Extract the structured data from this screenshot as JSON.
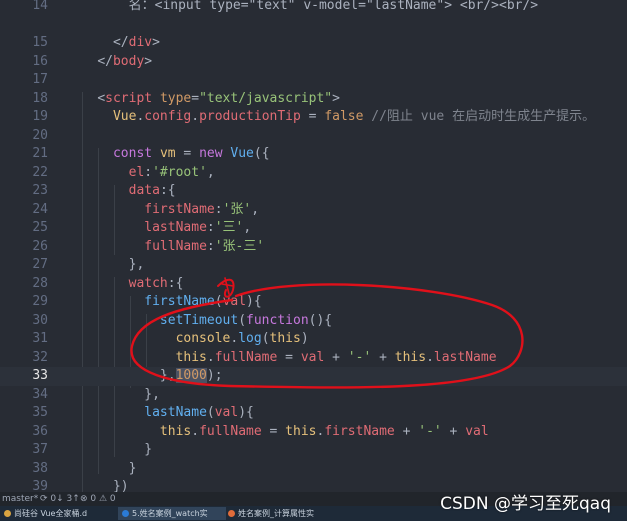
{
  "editor": {
    "current_line": 33,
    "lines": [
      {
        "no": "14",
        "tokens": [
          {
            "t": "        ",
            "c": "t-plain"
          },
          {
            "t": "名：<input type=\"text\" v-model=\"lastName\"> <br/><br/>",
            "c": "t-txt"
          }
        ]
      },
      {
        "no": "",
        "tokens": []
      },
      {
        "no": "15",
        "tokens": [
          {
            "t": "      ",
            "c": "t-plain"
          },
          {
            "t": "</",
            "c": "t-pun"
          },
          {
            "t": "div",
            "c": "t-tag"
          },
          {
            "t": ">",
            "c": "t-pun"
          }
        ]
      },
      {
        "no": "16",
        "tokens": [
          {
            "t": "    ",
            "c": "t-plain"
          },
          {
            "t": "</",
            "c": "t-pun"
          },
          {
            "t": "body",
            "c": "t-tag"
          },
          {
            "t": ">",
            "c": "t-pun"
          }
        ]
      },
      {
        "no": "17",
        "tokens": []
      },
      {
        "no": "18",
        "tokens": [
          {
            "t": "    ",
            "c": "t-plain"
          },
          {
            "t": "<",
            "c": "t-pun"
          },
          {
            "t": "script",
            "c": "t-tag"
          },
          {
            "t": " ",
            "c": "t-plain"
          },
          {
            "t": "type",
            "c": "t-attr"
          },
          {
            "t": "=",
            "c": "t-pun"
          },
          {
            "t": "\"text/javascript\"",
            "c": "t-str"
          },
          {
            "t": ">",
            "c": "t-pun"
          }
        ]
      },
      {
        "no": "19",
        "tokens": [
          {
            "t": "      ",
            "c": "t-plain"
          },
          {
            "t": "Vue",
            "c": "t-this"
          },
          {
            "t": ".",
            "c": "t-pun"
          },
          {
            "t": "config",
            "c": "t-prop"
          },
          {
            "t": ".",
            "c": "t-pun"
          },
          {
            "t": "productionTip",
            "c": "t-prop"
          },
          {
            "t": " = ",
            "c": "t-pun"
          },
          {
            "t": "false",
            "c": "t-num"
          },
          {
            "t": " ",
            "c": "t-plain"
          },
          {
            "t": "//阻止 vue 在启动时生成生产提示。",
            "c": "t-cm"
          }
        ]
      },
      {
        "no": "20",
        "tokens": []
      },
      {
        "no": "21",
        "tokens": [
          {
            "t": "      ",
            "c": "t-plain"
          },
          {
            "t": "const",
            "c": "t-kw"
          },
          {
            "t": " ",
            "c": "t-plain"
          },
          {
            "t": "vm",
            "c": "t-this"
          },
          {
            "t": " = ",
            "c": "t-pun"
          },
          {
            "t": "new",
            "c": "t-kw"
          },
          {
            "t": " ",
            "c": "t-plain"
          },
          {
            "t": "Vue",
            "c": "t-fn"
          },
          {
            "t": "({",
            "c": "t-pun"
          }
        ]
      },
      {
        "no": "22",
        "tokens": [
          {
            "t": "        ",
            "c": "t-plain"
          },
          {
            "t": "el",
            "c": "t-prop"
          },
          {
            "t": ":",
            "c": "t-pun"
          },
          {
            "t": "'#root'",
            "c": "t-str"
          },
          {
            "t": ",",
            "c": "t-pun"
          }
        ]
      },
      {
        "no": "23",
        "tokens": [
          {
            "t": "        ",
            "c": "t-plain"
          },
          {
            "t": "data",
            "c": "t-prop"
          },
          {
            "t": ":{",
            "c": "t-pun"
          }
        ]
      },
      {
        "no": "24",
        "tokens": [
          {
            "t": "          ",
            "c": "t-plain"
          },
          {
            "t": "firstName",
            "c": "t-prop"
          },
          {
            "t": ":",
            "c": "t-pun"
          },
          {
            "t": "'张'",
            "c": "t-str"
          },
          {
            "t": ",",
            "c": "t-pun"
          }
        ]
      },
      {
        "no": "25",
        "tokens": [
          {
            "t": "          ",
            "c": "t-plain"
          },
          {
            "t": "lastName",
            "c": "t-prop"
          },
          {
            "t": ":",
            "c": "t-pun"
          },
          {
            "t": "'三'",
            "c": "t-str"
          },
          {
            "t": ",",
            "c": "t-pun"
          }
        ]
      },
      {
        "no": "26",
        "tokens": [
          {
            "t": "          ",
            "c": "t-plain"
          },
          {
            "t": "fullName",
            "c": "t-prop"
          },
          {
            "t": ":",
            "c": "t-pun"
          },
          {
            "t": "'张-三'",
            "c": "t-str"
          }
        ]
      },
      {
        "no": "27",
        "tokens": [
          {
            "t": "        ",
            "c": "t-plain"
          },
          {
            "t": "},",
            "c": "t-pun"
          }
        ]
      },
      {
        "no": "28",
        "tokens": [
          {
            "t": "        ",
            "c": "t-plain"
          },
          {
            "t": "watch",
            "c": "t-prop"
          },
          {
            "t": ":{",
            "c": "t-pun"
          }
        ]
      },
      {
        "no": "29",
        "tokens": [
          {
            "t": "          ",
            "c": "t-plain"
          },
          {
            "t": "firstName",
            "c": "t-fn"
          },
          {
            "t": "(",
            "c": "t-pun"
          },
          {
            "t": "val",
            "c": "t-prop"
          },
          {
            "t": "){",
            "c": "t-pun"
          }
        ]
      },
      {
        "no": "30",
        "tokens": [
          {
            "t": "            ",
            "c": "t-plain"
          },
          {
            "t": "setTimeout",
            "c": "t-fn"
          },
          {
            "t": "(",
            "c": "t-pun"
          },
          {
            "t": "function",
            "c": "t-kw"
          },
          {
            "t": "(){",
            "c": "t-pun"
          }
        ]
      },
      {
        "no": "31",
        "tokens": [
          {
            "t": "              ",
            "c": "t-plain"
          },
          {
            "t": "console",
            "c": "t-this"
          },
          {
            "t": ".",
            "c": "t-pun"
          },
          {
            "t": "log",
            "c": "t-fn"
          },
          {
            "t": "(",
            "c": "t-pun"
          },
          {
            "t": "this",
            "c": "t-this"
          },
          {
            "t": ")",
            "c": "t-pun"
          }
        ]
      },
      {
        "no": "32",
        "tokens": [
          {
            "t": "              ",
            "c": "t-plain"
          },
          {
            "t": "this",
            "c": "t-this"
          },
          {
            "t": ".",
            "c": "t-pun"
          },
          {
            "t": "fullName",
            "c": "t-prop"
          },
          {
            "t": " = ",
            "c": "t-pun"
          },
          {
            "t": "val",
            "c": "t-prop"
          },
          {
            "t": " + ",
            "c": "t-pun"
          },
          {
            "t": "'-'",
            "c": "t-str"
          },
          {
            "t": " + ",
            "c": "t-pun"
          },
          {
            "t": "this",
            "c": "t-this"
          },
          {
            "t": ".",
            "c": "t-pun"
          },
          {
            "t": "lastName",
            "c": "t-prop"
          }
        ]
      },
      {
        "no": "33",
        "tokens": [
          {
            "t": "            ",
            "c": "t-plain"
          },
          {
            "t": "},",
            "c": "t-pun"
          },
          {
            "t": "1000",
            "c": "t-num sel-1000"
          },
          {
            "t": ");",
            "c": "t-pun"
          }
        ]
      },
      {
        "no": "34",
        "tokens": [
          {
            "t": "          ",
            "c": "t-plain"
          },
          {
            "t": "},",
            "c": "t-pun"
          }
        ]
      },
      {
        "no": "35",
        "tokens": [
          {
            "t": "          ",
            "c": "t-plain"
          },
          {
            "t": "lastName",
            "c": "t-fn"
          },
          {
            "t": "(",
            "c": "t-pun"
          },
          {
            "t": "val",
            "c": "t-prop"
          },
          {
            "t": "){",
            "c": "t-pun"
          }
        ]
      },
      {
        "no": "36",
        "tokens": [
          {
            "t": "            ",
            "c": "t-plain"
          },
          {
            "t": "this",
            "c": "t-this"
          },
          {
            "t": ".",
            "c": "t-pun"
          },
          {
            "t": "fullName",
            "c": "t-prop"
          },
          {
            "t": " = ",
            "c": "t-pun"
          },
          {
            "t": "this",
            "c": "t-this"
          },
          {
            "t": ".",
            "c": "t-pun"
          },
          {
            "t": "firstName",
            "c": "t-prop"
          },
          {
            "t": " + ",
            "c": "t-pun"
          },
          {
            "t": "'-'",
            "c": "t-str"
          },
          {
            "t": " + ",
            "c": "t-pun"
          },
          {
            "t": "val",
            "c": "t-prop"
          }
        ]
      },
      {
        "no": "37",
        "tokens": [
          {
            "t": "          ",
            "c": "t-plain"
          },
          {
            "t": "}",
            "c": "t-pun"
          }
        ]
      },
      {
        "no": "38",
        "tokens": [
          {
            "t": "        ",
            "c": "t-plain"
          },
          {
            "t": "}",
            "c": "t-pun"
          }
        ]
      },
      {
        "no": "39",
        "tokens": [
          {
            "t": "      ",
            "c": "t-plain"
          },
          {
            "t": "})",
            "c": "t-pun"
          }
        ]
      }
    ]
  },
  "statusbar": {
    "branch": "master*",
    "sync": "⟳ 0↓ 3↑",
    "problems": "⊗ 0 ⚠ 0"
  },
  "taskbar": {
    "items": [
      {
        "label": "尚硅谷 Vue全家桶.d",
        "color": "#d9a441"
      },
      {
        "label": "5.姓名案例_watch实",
        "color": "#2b7bd6"
      },
      {
        "label": "姓名案例_计算属性实",
        "color": "#e06c3a"
      }
    ]
  },
  "watermark": "CSDN @学习至死qaq",
  "colors": {
    "background": "#282c34",
    "annotation_ink": "#e0101a"
  }
}
